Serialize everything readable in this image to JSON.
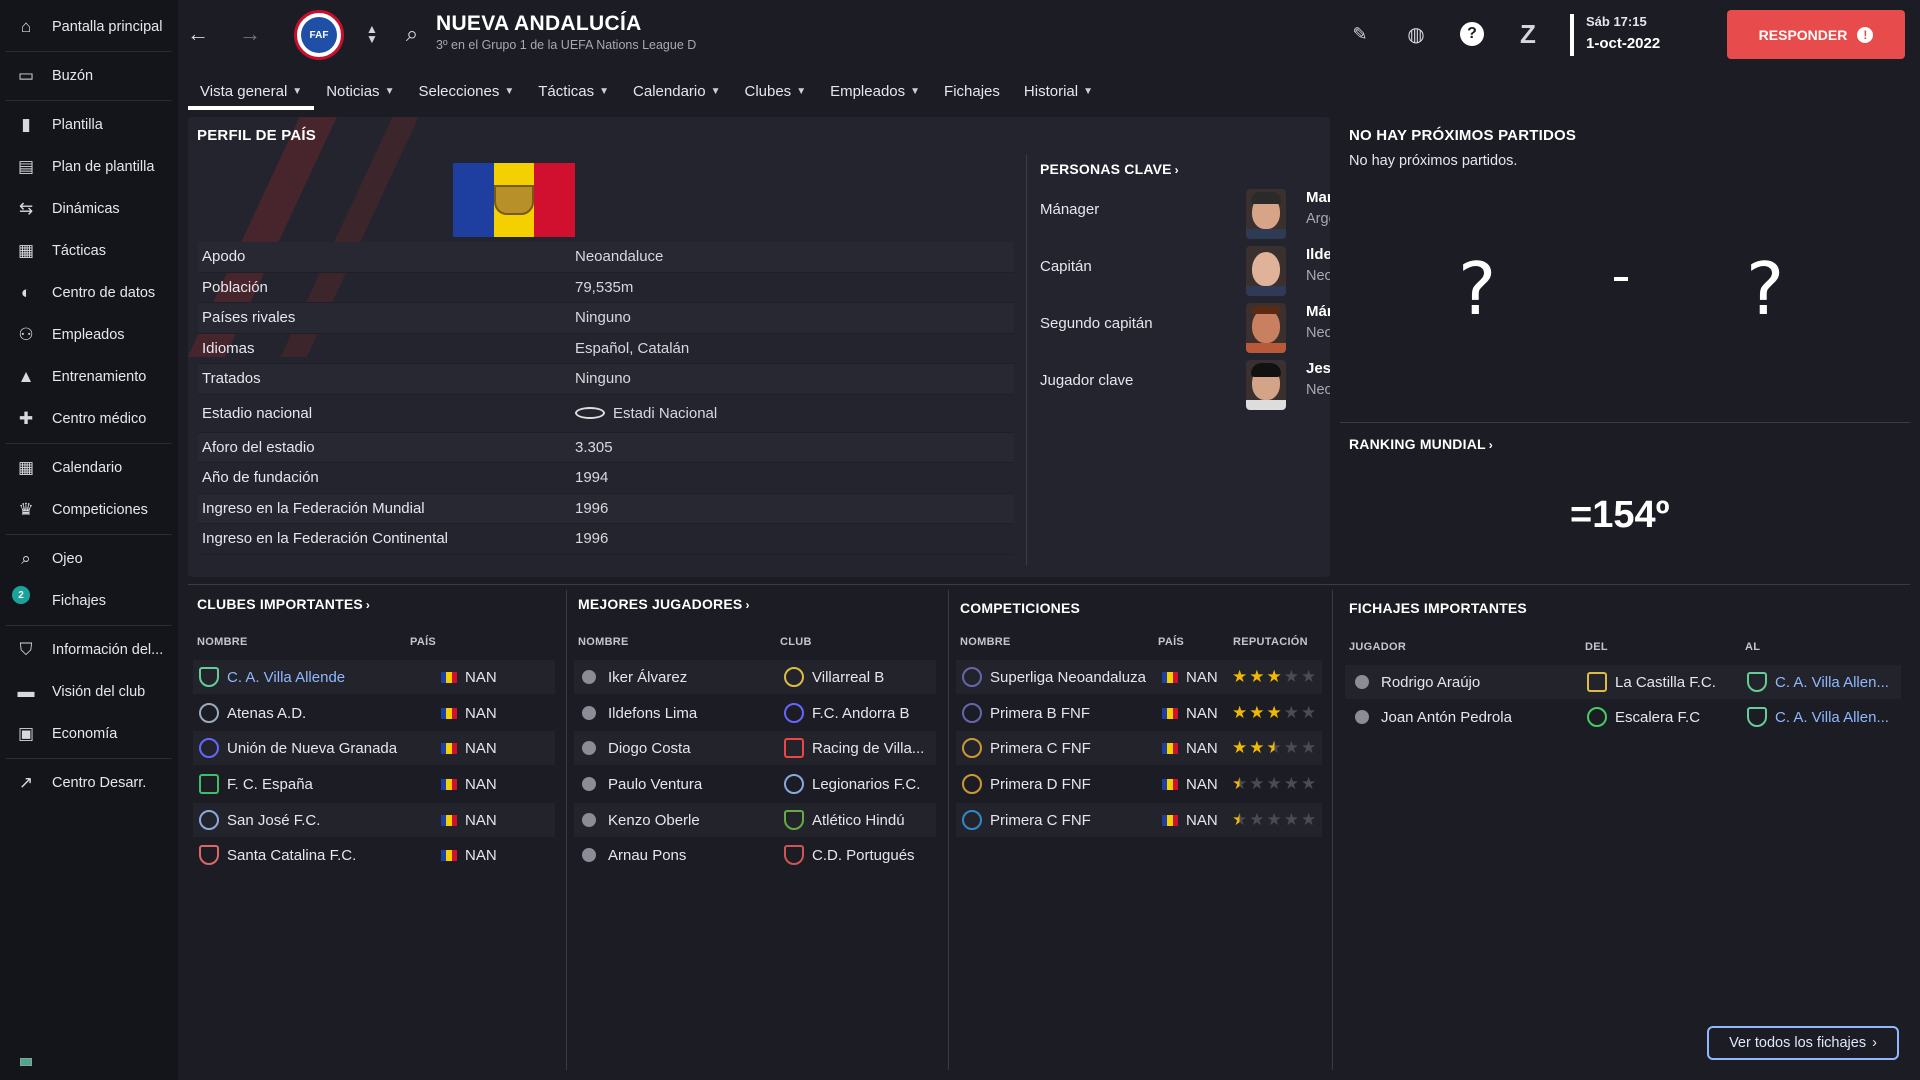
{
  "sidebar": {
    "items": [
      {
        "label": "Pantalla principal",
        "icon": "home-icon"
      },
      {
        "label": "Buzón",
        "icon": "inbox-icon"
      },
      {
        "label": "Plantilla",
        "icon": "shirt-icon"
      },
      {
        "label": "Plan de plantilla",
        "icon": "clipboard-icon"
      },
      {
        "label": "Dinámicas",
        "icon": "dynamics-icon"
      },
      {
        "label": "Tácticas",
        "icon": "tactics-icon"
      },
      {
        "label": "Centro de datos",
        "icon": "data-icon"
      },
      {
        "label": "Empleados",
        "icon": "staff-icon"
      },
      {
        "label": "Entrenamiento",
        "icon": "training-icon"
      },
      {
        "label": "Centro médico",
        "icon": "medical-icon"
      },
      {
        "label": "Calendario",
        "icon": "calendar-icon"
      },
      {
        "label": "Competiciones",
        "icon": "trophy-icon"
      },
      {
        "label": "Ojeo",
        "icon": "scouting-icon"
      },
      {
        "label": "Fichajes",
        "icon": "transfers-icon",
        "badge": "2"
      },
      {
        "label": "Información del...",
        "icon": "shield-icon"
      },
      {
        "label": "Visión del club",
        "icon": "vision-icon"
      },
      {
        "label": "Economía",
        "icon": "finance-icon"
      },
      {
        "label": "Centro Desarr.",
        "icon": "development-icon"
      }
    ]
  },
  "header": {
    "title": "NUEVA ANDALUCÍA",
    "subtitle": "3º en el Grupo 1 de la UEFA Nations League D",
    "logo_text": "FAF",
    "date_day": "Sáb 17:15",
    "date_full": "1-oct-2022",
    "respond_label": "RESPONDER"
  },
  "tabs": [
    {
      "label": "Vista general",
      "dropdown": true,
      "active": true
    },
    {
      "label": "Noticias",
      "dropdown": true
    },
    {
      "label": "Selecciones",
      "dropdown": true
    },
    {
      "label": "Tácticas",
      "dropdown": true
    },
    {
      "label": "Calendario",
      "dropdown": true
    },
    {
      "label": "Clubes",
      "dropdown": true
    },
    {
      "label": "Empleados",
      "dropdown": true
    },
    {
      "label": "Fichajes",
      "dropdown": false
    },
    {
      "label": "Historial",
      "dropdown": true
    }
  ],
  "profile": {
    "title": "PERFIL DE PAÍS",
    "rows": [
      {
        "key": "Apodo",
        "value": "Neoandaluce"
      },
      {
        "key": "Población",
        "value": "79,535m"
      },
      {
        "key": "Países rivales",
        "value": "Ninguno"
      },
      {
        "key": "Idiomas",
        "value": "Español, Catalán"
      },
      {
        "key": "Tratados",
        "value": "Ninguno"
      },
      {
        "key": "Estadio nacional",
        "value": "Estadi Nacional"
      },
      {
        "key": "Aforo del estadio",
        "value": "3.305"
      },
      {
        "key": "Año de fundación",
        "value": "1994"
      },
      {
        "key": "Ingreso en la Federación Mundial",
        "value": "1996"
      },
      {
        "key": "Ingreso en la Federación Continental",
        "value": "1996"
      }
    ]
  },
  "key_people": {
    "title": "PERSONAS CLAVE",
    "people": [
      {
        "role": "Mánager",
        "name": "Marcelo Gallardo",
        "nationality": "Argentino"
      },
      {
        "role": "Capitán",
        "name": "Ildefons Lima",
        "nationality": "Neoandaluz"
      },
      {
        "role": "Segundo capitán",
        "name": "Márcio",
        "nationality": "Neoandaluz"
      },
      {
        "role": "Jugador clave",
        "name": "Jesús Lara",
        "nationality": "Neoandaluz"
      }
    ]
  },
  "next_match": {
    "title": "NO HAY PRÓXIMOS PARTIDOS",
    "subtitle": "No hay próximos partidos.",
    "home": "?",
    "away": "?"
  },
  "ranking": {
    "title": "RANKING MUNDIAL",
    "value": "=154º"
  },
  "clubs": {
    "title": "CLUBES IMPORTANTES",
    "col_name": "NOMBRE",
    "col_country": "PAÍS",
    "rows": [
      {
        "name": "C. A. Villa Allende",
        "country": "NAN",
        "link": true
      },
      {
        "name": "Atenas A.D.",
        "country": "NAN"
      },
      {
        "name": "Unión de Nueva Granada",
        "country": "NAN"
      },
      {
        "name": "F. C. España",
        "country": "NAN"
      },
      {
        "name": "San José F.C.",
        "country": "NAN"
      },
      {
        "name": "Santa Catalina F.C.",
        "country": "NAN"
      }
    ]
  },
  "players": {
    "title": "MEJORES JUGADORES",
    "col_name": "NOMBRE",
    "col_club": "CLUB",
    "rows": [
      {
        "name": "Iker Álvarez",
        "club": "Villarreal B"
      },
      {
        "name": "Ildefons Lima",
        "club": "F.C. Andorra B"
      },
      {
        "name": "Diogo Costa",
        "club": "Racing de Villa..."
      },
      {
        "name": "Paulo Ventura",
        "club": "Legionarios F.C."
      },
      {
        "name": "Kenzo Oberle",
        "club": "Atlético Hindú"
      },
      {
        "name": "Arnau Pons",
        "club": "C.D. Portugués"
      }
    ]
  },
  "competitions": {
    "title": "COMPETICIONES",
    "col_name": "NOMBRE",
    "col_country": "PAÍS",
    "col_rep": "REPUTACIÓN",
    "rows": [
      {
        "name": "Superliga Neoandaluza",
        "country": "NAN",
        "stars": 3
      },
      {
        "name": "Primera B FNF",
        "country": "NAN",
        "stars": 3
      },
      {
        "name": "Primera C FNF",
        "country": "NAN",
        "stars": 2.5
      },
      {
        "name": "Primera D FNF",
        "country": "NAN",
        "stars": 0.5
      },
      {
        "name": "Primera C FNF",
        "country": "NAN",
        "stars": 0.5
      }
    ]
  },
  "transfers": {
    "title": "FICHAJES IMPORTANTES",
    "col_player": "JUGADOR",
    "col_from": "DEL",
    "col_to": "AL",
    "rows": [
      {
        "player": "Rodrigo Araújo",
        "from": "La Castilla F.C.",
        "to": "C. A. Villa Allen..."
      },
      {
        "player": "Joan Antón Pedrola",
        "from": "Escalera F.C",
        "to": "C. A. Villa Allen..."
      }
    ],
    "see_all": "Ver todos los fichajes"
  },
  "colors": {
    "accent_red": "#e74b4b",
    "link_blue": "#8fb8ff",
    "star": "#f2b705"
  }
}
